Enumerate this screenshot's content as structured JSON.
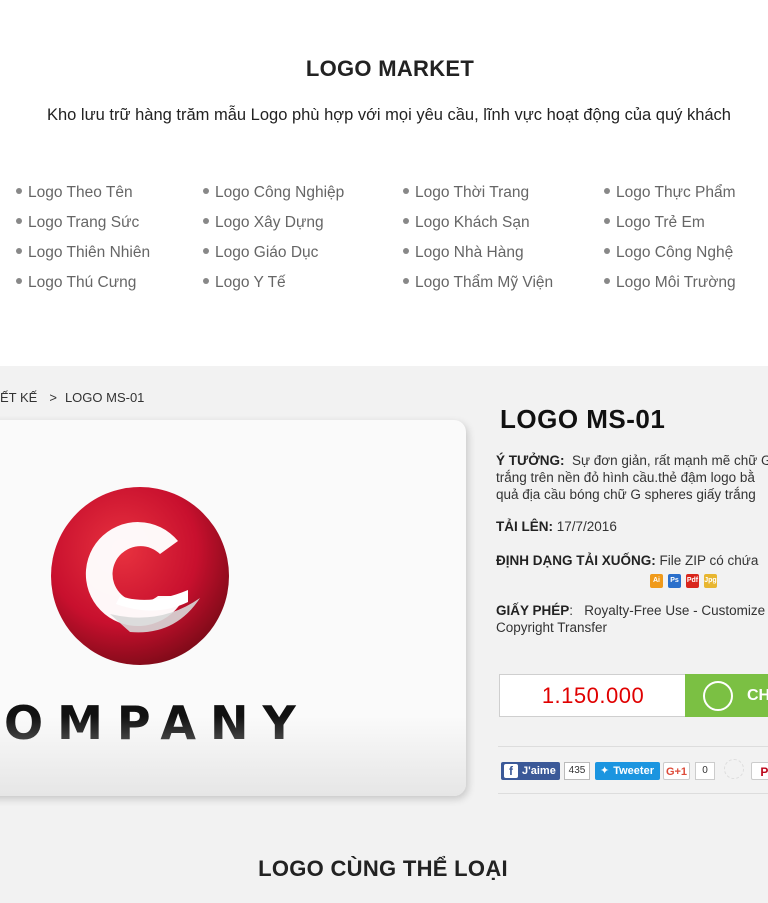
{
  "market": {
    "title": "LOGO MARKET",
    "subtitle": "Kho lưu trữ hàng trăm mẫu Logo phù hợp với mọi yêu cầu, lĩnh vực hoạt động của quý khách"
  },
  "categories": {
    "col1": [
      "Logo Theo Tên",
      "Logo Trang Sức",
      "Logo Thiên Nhiên",
      "Logo Thú Cưng"
    ],
    "col2": [
      "Logo Công Nghiệp",
      "Logo Xây Dựng",
      "Logo Giáo Dục",
      "Logo Y Tế"
    ],
    "col3": [
      "Logo Thời Trang",
      "Logo Khách Sạn",
      "Logo Nhà Hàng",
      "Logo Thẩm Mỹ Viện"
    ],
    "col4": [
      "Logo Thực Phẩm",
      "Logo Trẻ Em",
      "Logo Công Nghệ",
      "Logo Môi Trường"
    ]
  },
  "breadcrumb": {
    "parent": "ẾT KẾ",
    "separator": ">",
    "current": "LOGO MS-01"
  },
  "preview": {
    "brand_text": "OMPANY",
    "icon": "red-g-sphere-logo"
  },
  "product": {
    "title": "LOGO MS-01",
    "idea_label": "Ý TƯỞNG:",
    "idea_line1": "Sự đơn giản, rất mạnh mẽ chữ G",
    "idea_line2": "trắng trên nền đỏ hình cầu.thẻ đậm logo bằ",
    "idea_line3": "quả địa cầu bóng chữ G spheres giấy trắng",
    "uploaded_label": "TẢI LÊN:",
    "uploaded_value": "17/7/2016",
    "format_label": "ĐỊNH DẠNG TẢI XUỐNG:",
    "format_value": "File ZIP có chứa",
    "file_icons": [
      "ai-file-icon",
      "psd-file-icon",
      "pdf-file-icon",
      "jpg-file-icon"
    ],
    "license_label": "GIẤY PHÉP",
    "license_line1": "Royalty-Free Use - Customize",
    "license_line2": "Copyright Transfer",
    "price": "1.150.000",
    "buy_label": "CH"
  },
  "social": {
    "fb_label": "J'aime",
    "fb_count": "435",
    "tw_label": "Tweeter",
    "gp_label": "G+1",
    "gp_count": "0",
    "pin_label": "Pi"
  },
  "same_category": {
    "title": "LOGO CÙNG THỂ LOẠI"
  },
  "colors": {
    "price": "#e00000",
    "buy_button": "#7bc043",
    "logo_red": "#c8102e",
    "facebook": "#3b5998",
    "twitter": "#1b95e0"
  }
}
